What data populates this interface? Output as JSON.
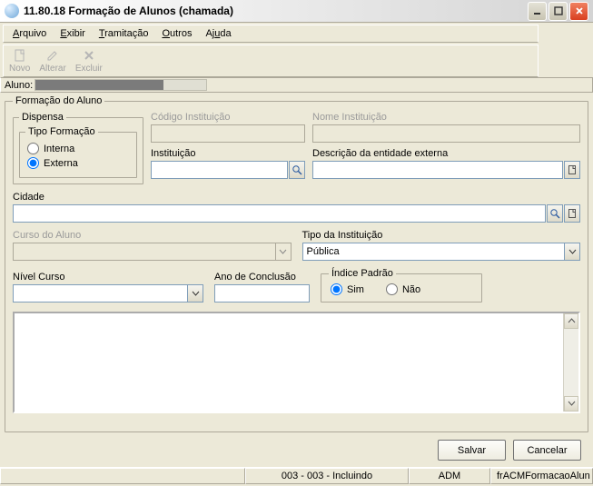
{
  "window": {
    "title": "11.80.18 Formação de Alunos (chamada)"
  },
  "menu": {
    "arquivo": "Arquivo",
    "exibir": "Exibir",
    "tramitacao": "Tramitação",
    "outros": "Outros",
    "ajuda": "Ajuda"
  },
  "toolbar": {
    "novo": "Novo",
    "alterar": "Alterar",
    "excluir": "Excluir"
  },
  "aluno_bar": {
    "label": "Aluno:"
  },
  "form": {
    "legend_main": "Formação do Aluno",
    "legend_dispensa": "Dispensa",
    "legend_tipo": "Tipo Formação",
    "radio_interna": "Interna",
    "radio_externa": "Externa",
    "radio_selected": "externa",
    "codigo_inst_label": "Código Instituição",
    "codigo_inst_value": "",
    "nome_inst_label": "Nome Instituição",
    "nome_inst_value": "",
    "instituicao_label": "Instituição",
    "instituicao_value": "",
    "descricao_ent_label": "Descrição da entidade externa",
    "descricao_ent_value": "",
    "cidade_label": "Cidade",
    "cidade_value": "",
    "curso_aluno_label": "Curso do Aluno",
    "curso_aluno_value": "",
    "tipo_inst_label": "Tipo da Instituição",
    "tipo_inst_value": "Pública",
    "nivel_curso_label": "Nível Curso",
    "nivel_curso_value": "",
    "ano_conclusao_label": "Ano de Conclusão",
    "ano_conclusao_value": "",
    "indice_legend": "Índice Padrão",
    "indice_sim": "Sim",
    "indice_nao": "Não",
    "indice_selected": "sim"
  },
  "buttons": {
    "salvar": "Salvar",
    "cancelar": "Cancelar"
  },
  "status": {
    "cell1": "",
    "cell2": "003 - 003 - Incluindo",
    "cell3": "ADM",
    "cell4": "frACMFormacaoAlun"
  }
}
